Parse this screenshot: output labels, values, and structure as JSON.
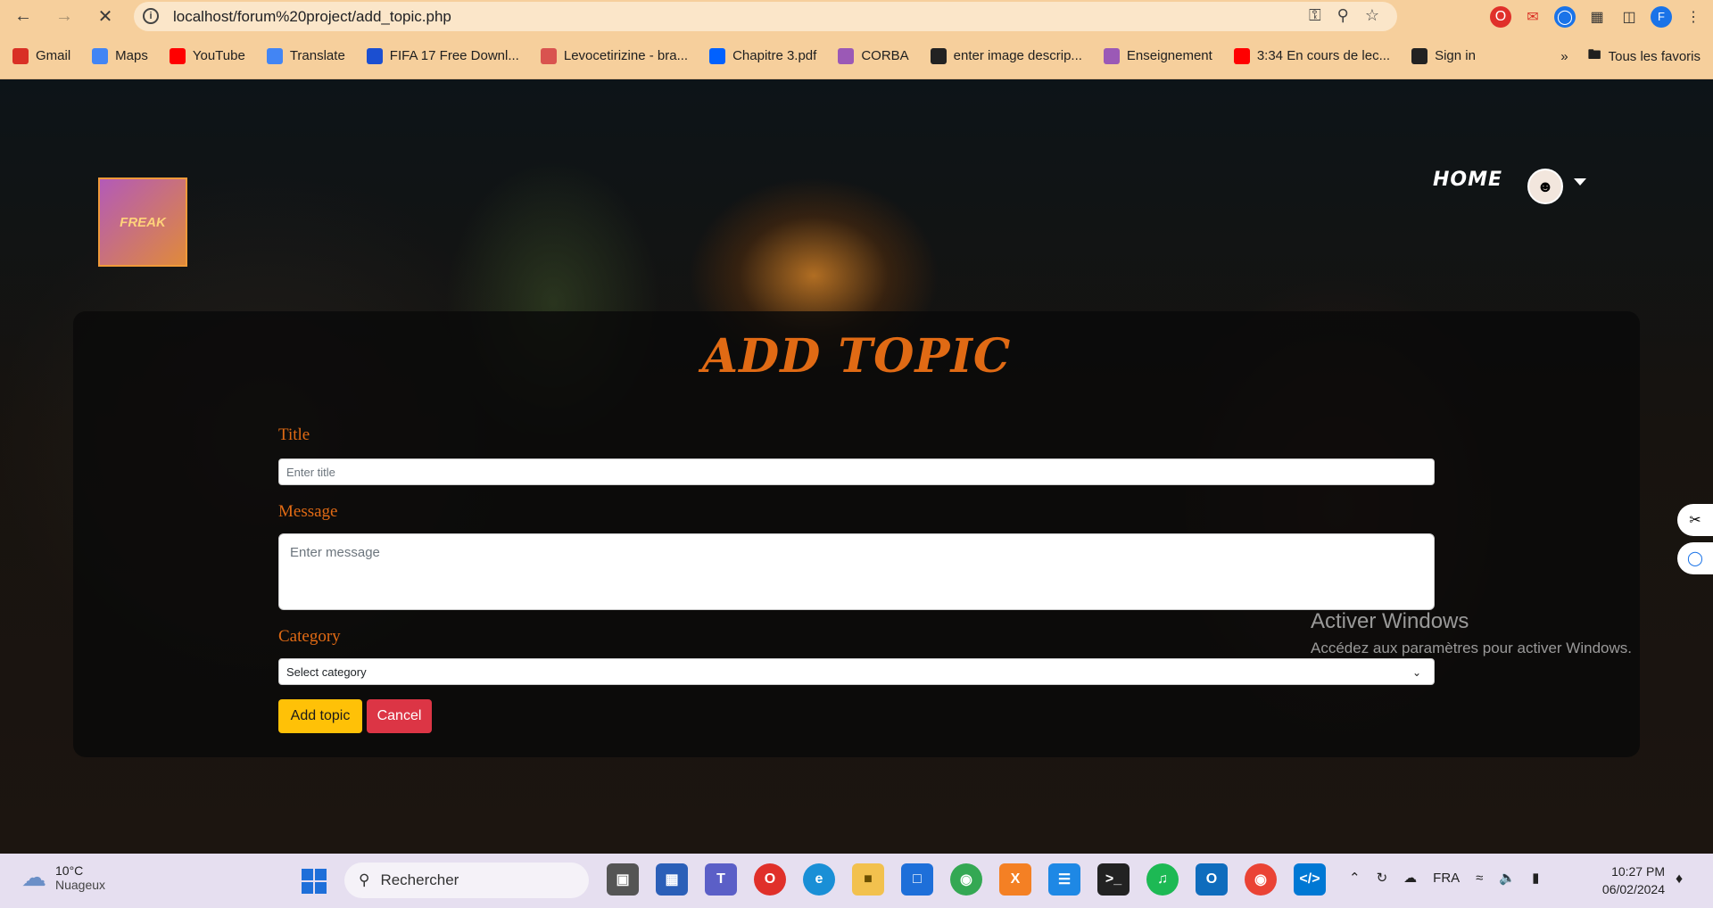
{
  "browser": {
    "url": "localhost/forum%20project/add_topic.php",
    "bookmarks": [
      {
        "label": "Gmail",
        "icon": "gmail-icon",
        "color": "#d93025"
      },
      {
        "label": "Maps",
        "icon": "google-icon",
        "color": "#4285f4"
      },
      {
        "label": "YouTube",
        "icon": "youtube-icon",
        "color": "#ff0000"
      },
      {
        "label": "Translate",
        "icon": "translate-icon",
        "color": "#4285f4"
      },
      {
        "label": "FIFA 17 Free Downl...",
        "icon": "s-icon",
        "color": "#1b4fd1"
      },
      {
        "label": "Levocetirizine - bra...",
        "icon": "molecule-icon",
        "color": "#d9534f"
      },
      {
        "label": "Chapitre 3.pdf",
        "icon": "dropbox-icon",
        "color": "#0061ff"
      },
      {
        "label": "CORBA",
        "icon": "bookmark-icon",
        "color": "#9b59b6"
      },
      {
        "label": "enter image descrip...",
        "icon": "info-icon",
        "color": "#222222"
      },
      {
        "label": "Enseignement",
        "icon": "bookmark-icon",
        "color": "#9b59b6"
      },
      {
        "label": "3:34 En cours de lec...",
        "icon": "youtube-icon",
        "color": "#ff0000"
      },
      {
        "label": "Sign in",
        "icon": "github-icon",
        "color": "#222222"
      }
    ],
    "all_bookmarks_label": "Tous les favoris",
    "profile_initial": "F"
  },
  "site": {
    "logo_text": "FREAK",
    "nav_home": "HOME"
  },
  "form": {
    "heading": "ADD TOPIC",
    "title_label": "Title",
    "title_placeholder": "Enter title",
    "message_label": "Message",
    "message_placeholder": "Enter message",
    "category_label": "Category",
    "category_selected": "Select category",
    "submit_label": "Add topic",
    "cancel_label": "Cancel"
  },
  "windows_notice": {
    "title": "Activer Windows",
    "subtitle": "Accédez aux paramètres pour activer Windows."
  },
  "taskbar": {
    "temperature": "10°C",
    "weather": "Nuageux",
    "search_placeholder": "Rechercher",
    "language": "FRA",
    "time": "10:27 PM",
    "date": "06/02/2024"
  },
  "colors": {
    "accent_orange": "#e06a14",
    "add_button": "#ffc107",
    "cancel_button": "#dc3545",
    "browser_chrome": "#f6cf9c"
  }
}
